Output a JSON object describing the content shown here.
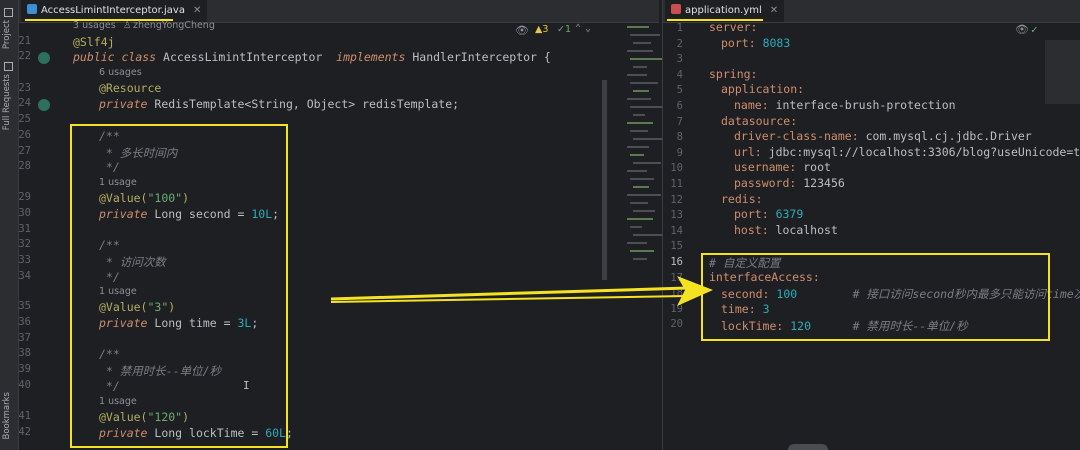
{
  "sidebar": {
    "project_label": "Project",
    "full_requests_label": "Full Requests",
    "bookmarks_label": "Bookmarks"
  },
  "left_editor": {
    "tab_label": "AccessLimintInterceptor.java",
    "inspections": {
      "warnings": "3",
      "weak_warnings": "1"
    },
    "hints": {
      "class_usages": "3 usages",
      "author": "zhengYongCheng",
      "field_usages": "6 usages",
      "usage_1": "1 usage",
      "usage_2": "1 usage",
      "usage_3": "1 usage"
    },
    "line_numbers": [
      "21",
      "22",
      "23",
      "24",
      "25",
      "26",
      "27",
      "28",
      "29",
      "30",
      "31",
      "32",
      "33",
      "34",
      "35",
      "36",
      "37",
      "38",
      "39",
      "40",
      "41",
      "42"
    ],
    "code": {
      "l21_annotation": "@Slf4j",
      "l22_public": "public",
      "l22_class": "class",
      "l22_name": "AccessLimintInterceptor",
      "l22_implements": "implements",
      "l22_interface": "HandlerInterceptor {",
      "l23_annotation": "@Resource",
      "l24_private": "private",
      "l24_type": "RedisTemplate<String, Object> redisTemplate;",
      "l26": "/**",
      "l27": " * 多长时间内",
      "l28": " */",
      "l29_ann": "@Value(",
      "l29_str": "\"100\"",
      "l29_close": ")",
      "l30_private": "private",
      "l30_decl": "Long second = ",
      "l30_num": "10L",
      "l30_end": ";",
      "l32": "/**",
      "l33": " * 访问次数",
      "l34": " */",
      "l35_ann": "@Value(",
      "l35_str": "\"3\"",
      "l35_close": ")",
      "l36_private": "private",
      "l36_decl": "Long time = ",
      "l36_num": "3L",
      "l36_end": ";",
      "l38": "/**",
      "l39": " * 禁用时长--单位/秒",
      "l40": " */",
      "l41_ann": "@Value(",
      "l41_str": "\"120\"",
      "l41_close": ")",
      "l42_private": "private",
      "l42_decl": "Long lockTime = ",
      "l42_num": "60L",
      "l42_end": ";"
    }
  },
  "right_editor": {
    "tab_label": "application.yml",
    "line_numbers": [
      "1",
      "2",
      "3",
      "4",
      "5",
      "6",
      "7",
      "8",
      "9",
      "10",
      "11",
      "12",
      "13",
      "14",
      "15",
      "16",
      "17",
      "18",
      "19",
      "20"
    ],
    "yaml": {
      "l1": "server:",
      "l2_key": "port:",
      "l2_val": "8083",
      "l4": "spring:",
      "l5": "application:",
      "l6_key": "name:",
      "l6_val": "interface-brush-protection",
      "l7": "datasource:",
      "l8_key": "driver-class-name:",
      "l8_val": "com.mysql.cj.jdbc.Driver",
      "l9_key": "url:",
      "l9_val": "jdbc:mysql://localhost:3306/blog?useUnicode=t",
      "l10_key": "username:",
      "l10_val": "root",
      "l11_key": "password:",
      "l11_val": "123456",
      "l12": "redis:",
      "l13_key": "port:",
      "l13_val": "6379",
      "l14_key": "host:",
      "l14_val": "localhost",
      "l16": "# 自定义配置",
      "l17": "interfaceAccess:",
      "l18_key": "second:",
      "l18_val": "100",
      "l18_comment": "# 接口访问second秒内最多只能访问time次",
      "l19_key": "time:",
      "l19_val": "3",
      "l20_key": "lockTime:",
      "l20_val": "120",
      "l20_comment": "# 禁用时长--单位/秒"
    }
  },
  "colors": {
    "highlight": "#f5e223",
    "background": "#1e1f22",
    "keyword": "#cf8e6d",
    "annotation": "#b3ae60",
    "string": "#6aab73",
    "number": "#2aacb8",
    "comment": "#7a7e85"
  }
}
